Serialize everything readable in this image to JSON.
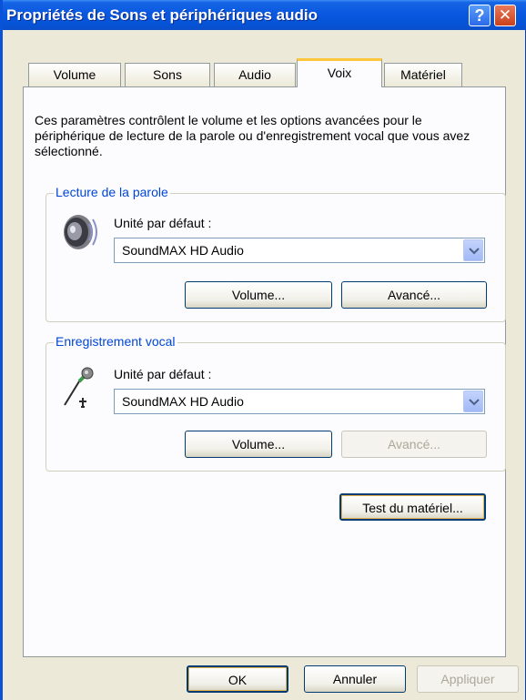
{
  "window": {
    "title": "Propriétés de Sons et périphériques audio",
    "help_label": "?",
    "close_label": "✕"
  },
  "tabs": [
    {
      "label": "Volume"
    },
    {
      "label": "Sons"
    },
    {
      "label": "Audio"
    },
    {
      "label": "Voix"
    },
    {
      "label": "Matériel"
    }
  ],
  "active_tab": "Voix",
  "intro_text": "Ces paramètres contrôlent le volume et les options avancées pour le périphérique de lecture de la parole ou d'enregistrement vocal que vous avez sélectionné.",
  "playback": {
    "legend": "Lecture de la parole",
    "label": "Unité par défaut :",
    "device": "SoundMAX HD Audio",
    "volume_button": "Volume...",
    "advanced_button": "Avancé..."
  },
  "recording": {
    "legend": "Enregistrement vocal",
    "label": "Unité par défaut :",
    "device": "SoundMAX HD Audio",
    "volume_button": "Volume...",
    "advanced_button": "Avancé..."
  },
  "test_button": "Test du matériel...",
  "footer": {
    "ok": "OK",
    "cancel": "Annuler",
    "apply": "Appliquer"
  },
  "colors": {
    "titlebar": "#0553d6",
    "group_legend": "#0046d5",
    "tab_highlight": "#ffc83c"
  },
  "icons": {
    "playback": "speaker-icon",
    "recording": "microphone-icon",
    "dropdown": "chevron-down-icon"
  }
}
